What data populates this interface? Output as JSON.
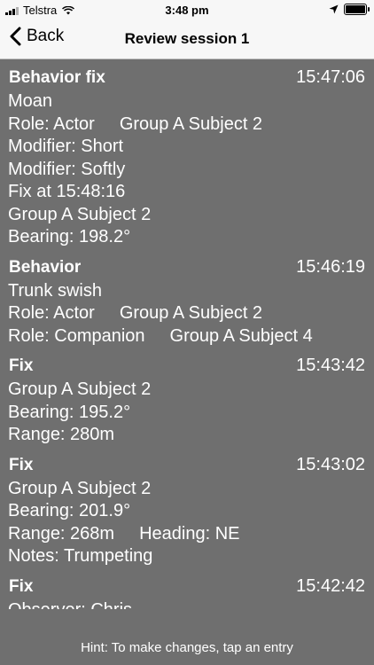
{
  "status": {
    "carrier": "Telstra",
    "time": "3:48 pm",
    "battery_level": 0.9
  },
  "nav": {
    "back_label": "Back",
    "title": "Review session 1"
  },
  "entries": [
    {
      "type": "Behavior fix",
      "time": "15:47:06",
      "lines": [
        [
          "Moan"
        ],
        [
          "Role: Actor",
          "Group A Subject 2"
        ],
        [
          "Modifier: Short"
        ],
        [
          "Modifier: Softly"
        ],
        [
          "Fix at 15:48:16"
        ],
        [
          "Group A Subject 2"
        ],
        [
          "Bearing: 198.2°"
        ]
      ]
    },
    {
      "type": "Behavior",
      "time": "15:46:19",
      "lines": [
        [
          "Trunk swish"
        ],
        [
          "Role: Actor",
          "Group A Subject 2"
        ],
        [
          "Role: Companion",
          "Group A Subject 4"
        ]
      ]
    },
    {
      "type": "Fix",
      "time": "15:43:42",
      "lines": [
        [
          "Group A Subject 2"
        ],
        [
          "Bearing: 195.2°"
        ],
        [
          "Range: 280m"
        ]
      ]
    },
    {
      "type": "Fix",
      "time": "15:43:02",
      "lines": [
        [
          "Group A Subject 2"
        ],
        [
          "Bearing: 201.9°"
        ],
        [
          "Range: 268m",
          "Heading: NE"
        ],
        [
          "Notes: Trumpeting"
        ]
      ]
    },
    {
      "type": "Fix",
      "time": "15:42:42",
      "lines": [
        [
          "Observer: Chris"
        ]
      ]
    }
  ],
  "hint": "Hint: To make changes, tap an entry",
  "colors": {
    "background": "#6f6f6f",
    "bar": "#f7f7f7",
    "text": "#ffffff"
  }
}
